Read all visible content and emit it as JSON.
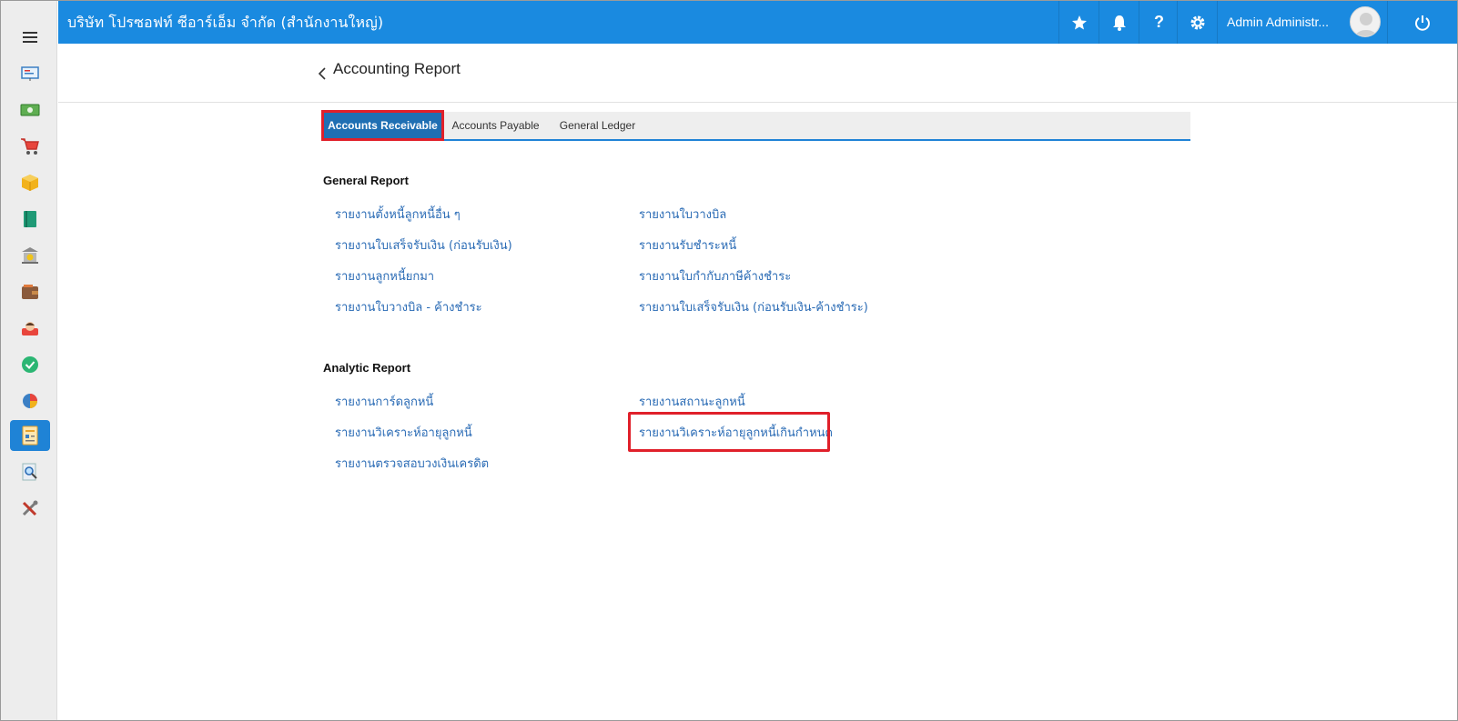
{
  "app": {
    "company_title": "บริษัท โปรซอฟท์ ซีอาร์เอ็ม จำกัด (สำนักงานใหญ่)",
    "user_name": "Admin Administr...",
    "accent_color": "#1a8ae0"
  },
  "sidebar": {
    "items": [
      {
        "icon": "hamburger-menu-icon"
      },
      {
        "icon": "presentation-board-icon"
      },
      {
        "icon": "money-icon"
      },
      {
        "icon": "shopping-cart-icon"
      },
      {
        "icon": "box-icon"
      },
      {
        "icon": "book-icon"
      },
      {
        "icon": "bank-icon"
      },
      {
        "icon": "wallet-icon"
      },
      {
        "icon": "contact-person-icon"
      },
      {
        "icon": "check-circle-icon"
      },
      {
        "icon": "pie-chart-icon"
      },
      {
        "icon": "report-document-icon",
        "active": true
      },
      {
        "icon": "magnifier-search-icon"
      },
      {
        "icon": "tools-icon"
      }
    ]
  },
  "header": {
    "title": "Accounting Report"
  },
  "tabs": [
    {
      "label": "Accounts Receivable",
      "active": true
    },
    {
      "label": "Accounts Payable",
      "active": false
    },
    {
      "label": "General Ledger",
      "active": false
    }
  ],
  "general_report": {
    "title": "General Report",
    "left": [
      "รายงานตั้งหนี้ลูกหนี้อื่น ๆ",
      "รายงานใบเสร็จรับเงิน (ก่อนรับเงิน)",
      "รายงานลูกหนี้ยกมา",
      "รายงานใบวางบิล - ค้างชำระ"
    ],
    "right": [
      "รายงานใบวางบิล",
      "รายงานรับชำระหนี้",
      "รายงานใบกำกับภาษีค้างชำระ",
      "รายงานใบเสร็จรับเงิน (ก่อนรับเงิน-ค้างชำระ)"
    ]
  },
  "analytic_report": {
    "title": "Analytic Report",
    "left": [
      "รายงานการ์ดลูกหนี้",
      "รายงานวิเคราะห์อายุลูกหนี้",
      "รายงานตรวจสอบวงเงินเครดิต"
    ],
    "right": [
      "รายงานสถานะลูกหนี้",
      "รายงานวิเคราะห์อายุลูกหนี้เกินกำหนด"
    ]
  }
}
